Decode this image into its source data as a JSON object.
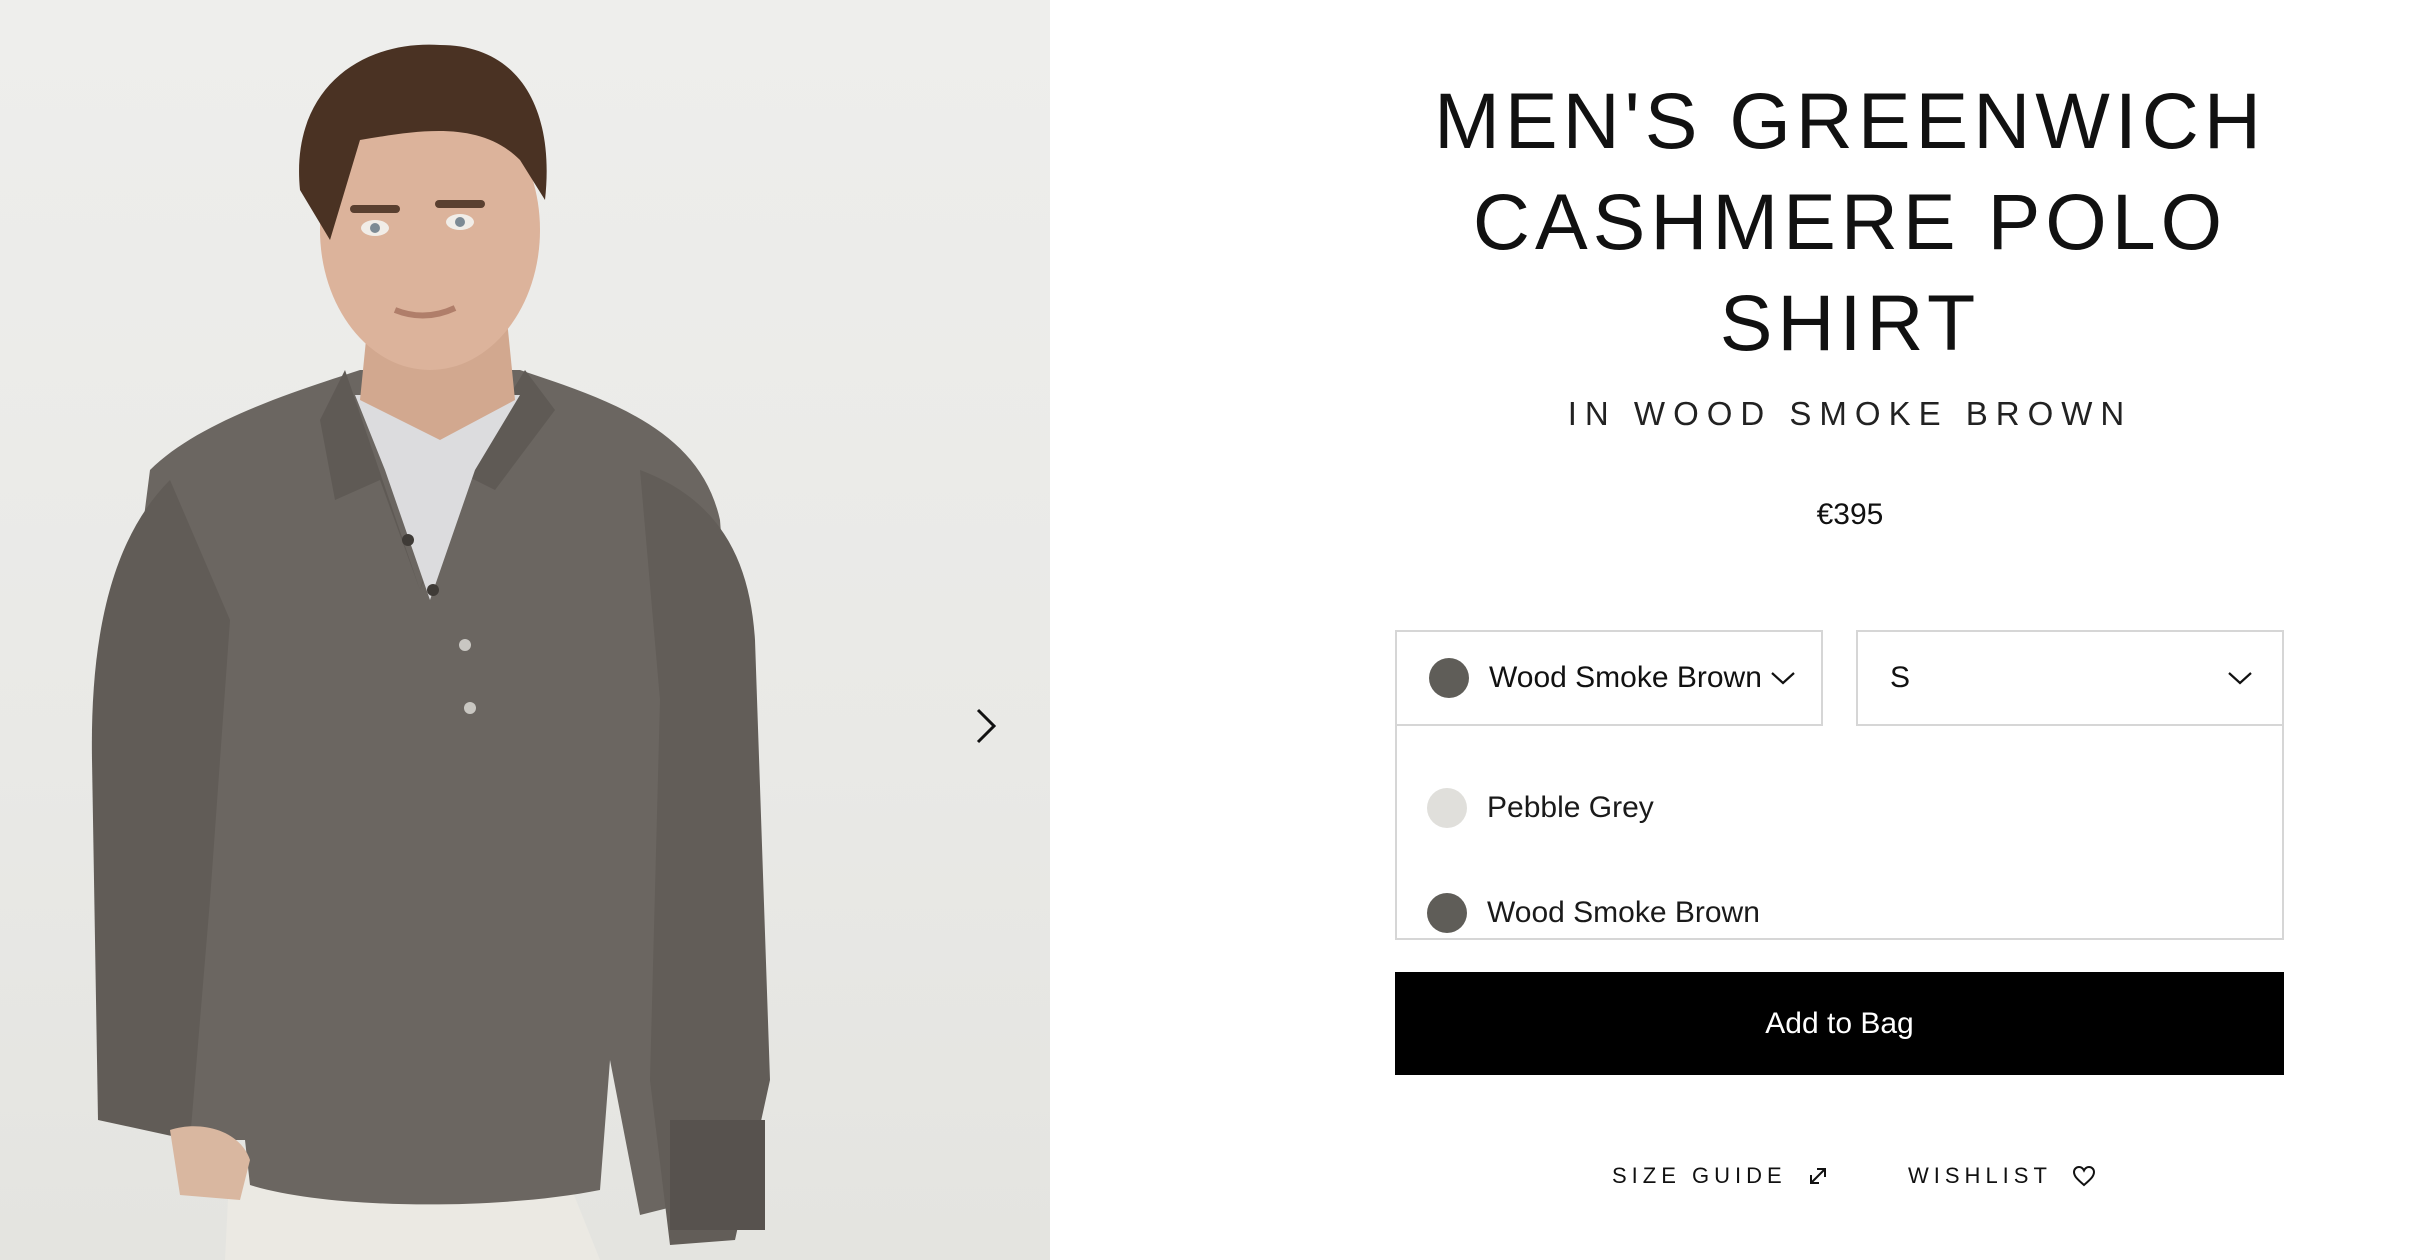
{
  "gallery": {
    "next_icon": "chevron-right-icon"
  },
  "product": {
    "title_lines": [
      "MEN'S GREENWICH",
      "CASHMERE POLO",
      "SHIRT"
    ],
    "subtitle": "IN WOOD SMOKE BROWN",
    "price": "€395"
  },
  "color_select": {
    "selected": "Wood Smoke Brown",
    "selected_swatch": "#5f5d58",
    "icon": "chevron-down-icon",
    "options": [
      {
        "label": "Pebble Grey",
        "swatch": "#e0dfdb"
      },
      {
        "label": "Wood Smoke Brown",
        "swatch": "#5f5d58"
      }
    ]
  },
  "size_select": {
    "selected": "S",
    "icon": "chevron-down-icon"
  },
  "actions": {
    "add_to_bag": "Add to Bag",
    "size_guide": "SIZE GUIDE",
    "size_guide_icon": "external-link-icon",
    "wishlist": "WISHLIST",
    "wishlist_icon": "heart-icon"
  },
  "colors": {
    "button_bg": "#000000",
    "border": "#d6d6d6",
    "sweater": "#6b6661",
    "background": "#eceae7"
  }
}
